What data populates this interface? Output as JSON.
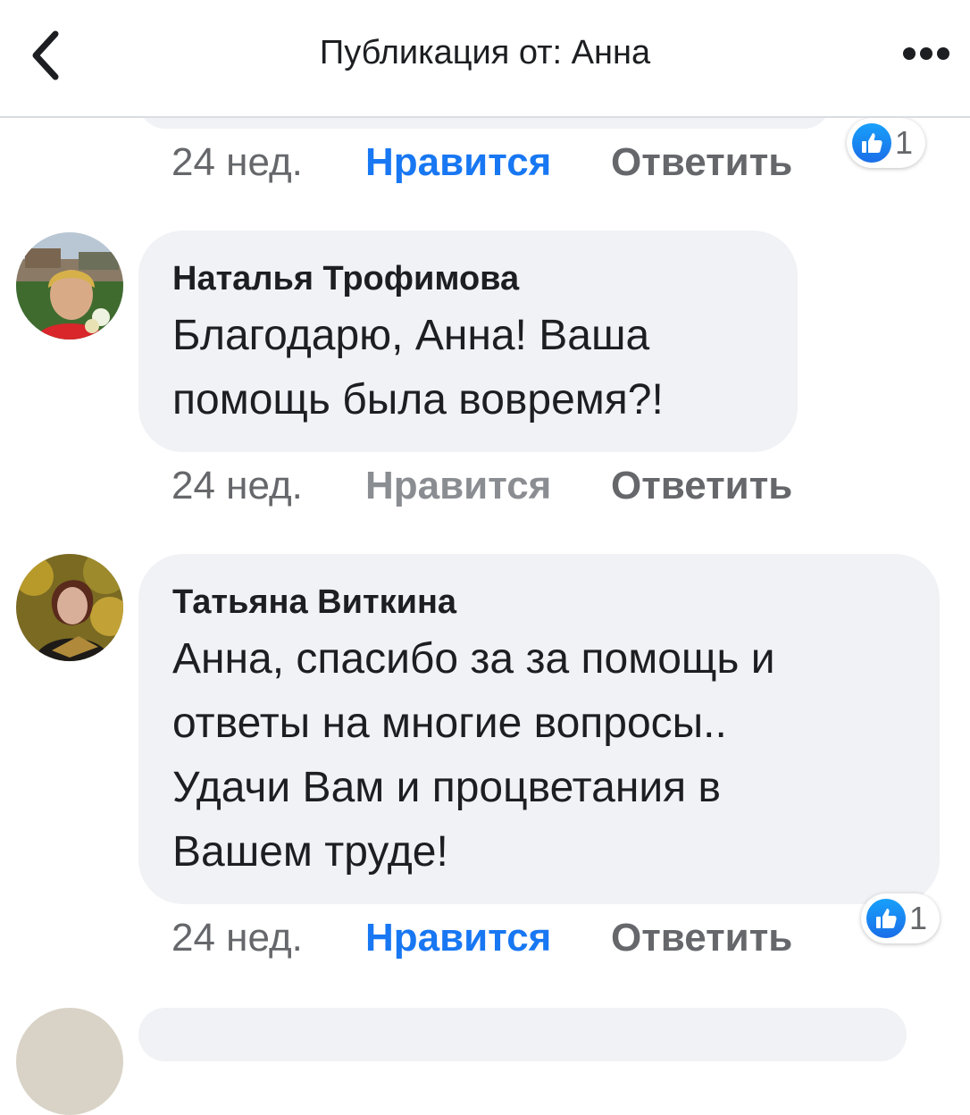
{
  "header": {
    "title": "Публикация от: Анна",
    "back_icon": "chevron-left-icon",
    "more_icon": "more-horizontal-icon"
  },
  "prev_comment": {
    "time": "24 нед.",
    "like_label": "Нравится",
    "like_active": true,
    "reply_label": "Ответить",
    "reaction_count": "1"
  },
  "comments": [
    {
      "author": "Наталья Трофимова",
      "text_lines": [
        "Благодарю, Анна!  Ваша",
        "помощь была вовремя?!"
      ],
      "time": "24 нед.",
      "like_label": "Нравится",
      "like_active": false,
      "reply_label": "Ответить"
    },
    {
      "author": "Татьяна Виткина",
      "text_lines": [
        "Анна, спасибо за за помощь и",
        "ответы на многие вопросы..",
        "Удачи Вам и процветания в",
        "Вашем труде!"
      ],
      "time": "24 нед.",
      "like_label": "Нравится",
      "like_active": true,
      "reply_label": "Ответить",
      "reaction_count": "1"
    }
  ],
  "colors": {
    "accent": "#1877f2",
    "bubble": "#f0f2f5",
    "secondary_text": "#65676b"
  }
}
